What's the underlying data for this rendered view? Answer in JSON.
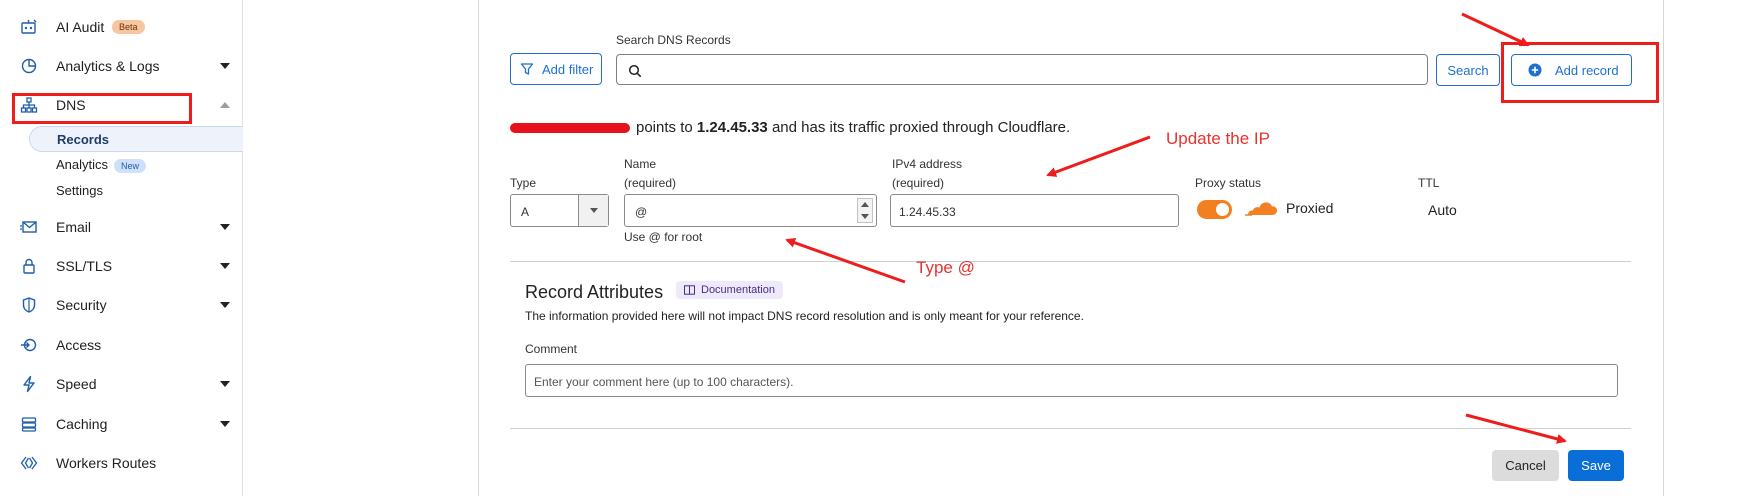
{
  "sidebar": {
    "ai_audit": "AI Audit",
    "ai_audit_badge": "Beta",
    "analytics_logs": "Analytics & Logs",
    "dns": "DNS",
    "dns_sub": {
      "records": "Records",
      "analytics": "Analytics",
      "analytics_badge": "New",
      "settings": "Settings"
    },
    "email": "Email",
    "ssl_tls": "SSL/TLS",
    "security": "Security",
    "access": "Access",
    "speed": "Speed",
    "caching": "Caching",
    "workers_routes": "Workers Routes"
  },
  "toolbar": {
    "add_filter": "Add filter",
    "search_label": "Search DNS Records",
    "search_value": "",
    "search_button": "Search",
    "add_record": "Add record"
  },
  "record_summary": {
    "prefix_hidden": "",
    "text_before": "points to ",
    "ip": "1.24.45.33",
    "text_after": " and has its traffic proxied through Cloudflare."
  },
  "form": {
    "type_label": "Type",
    "type_value": "A",
    "name_label": "Name",
    "name_required": "(required)",
    "name_value": "@",
    "name_hint": "Use @ for root",
    "ipv4_label": "IPv4 address",
    "ipv4_required": "(required)",
    "ipv4_value": "1.24.45.33",
    "proxy_label": "Proxy status",
    "proxy_value": "Proxied",
    "proxy_on": true,
    "ttl_label": "TTL",
    "ttl_value": "Auto"
  },
  "attributes": {
    "title": "Record Attributes",
    "doc_badge": "Documentation",
    "description": "The information provided here will not impact DNS record resolution and is only meant for your reference.",
    "comment_label": "Comment",
    "comment_placeholder": "Enter your comment here (up to 100 characters)."
  },
  "actions": {
    "cancel": "Cancel",
    "save": "Save"
  },
  "annotations": {
    "update_ip": "Update the IP",
    "type_at": "Type @"
  },
  "colors": {
    "accent": "#1f6fd1",
    "save_button": "#0a6ed8",
    "proxy_orange": "#f38020",
    "annotation_red": "#ef1c1c"
  }
}
